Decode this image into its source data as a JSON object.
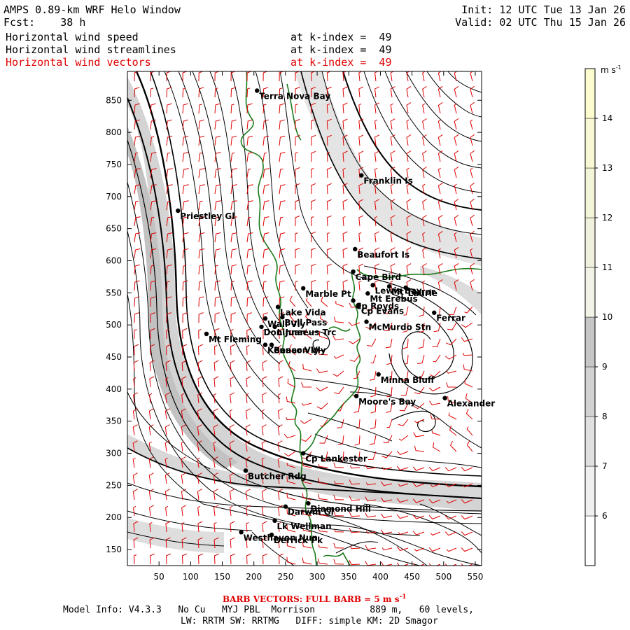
{
  "header": {
    "title": "AMPS 0.89-km WRF Helo Window",
    "fcst_label": "Fcst:",
    "fcst_value": "38 h",
    "init": "Init: 12 UTC Tue 13 Jan 26",
    "valid": "Valid: 02 UTC Thu 15 Jan 26",
    "fields": [
      {
        "name": "Horizontal wind speed",
        "level": "at k-index =  49",
        "color": "#000000"
      },
      {
        "name": "Horizontal wind streamlines",
        "level": "at k-index =  49",
        "color": "#000000"
      },
      {
        "name": "Horizontal wind vectors",
        "level": "at k-index =  49",
        "color": "#e00000"
      }
    ]
  },
  "map": {
    "x_ticks": [
      "50",
      "100",
      "150",
      "200",
      "250",
      "300",
      "350",
      "400",
      "450",
      "500",
      "550"
    ],
    "y_ticks": [
      "850",
      "800",
      "750",
      "700",
      "650",
      "600",
      "550",
      "500",
      "450",
      "400",
      "350",
      "300",
      "250",
      "200",
      "150"
    ],
    "x_range": [
      0,
      560
    ],
    "y_range": [
      125,
      895
    ],
    "coast_color": "#1a7a1a",
    "barb_color": "#e00000",
    "places": [
      {
        "name": "Terra Nova Bay",
        "x": 205,
        "y": 865
      },
      {
        "name": "Franklin Is",
        "x": 370,
        "y": 733
      },
      {
        "name": "Priestley Gl",
        "x": 80,
        "y": 678
      },
      {
        "name": "Beaufort Is",
        "x": 360,
        "y": 618
      },
      {
        "name": "Cape Bird",
        "x": 357,
        "y": 583
      },
      {
        "name": "Marble Pt",
        "x": 278,
        "y": 557
      },
      {
        "name": "Lewis Bay",
        "x": 388,
        "y": 562
      },
      {
        "name": "Mt Terror",
        "x": 414,
        "y": 560
      },
      {
        "name": "Lake Vida",
        "x": 238,
        "y": 528
      },
      {
        "name": "Cp Royds",
        "x": 357,
        "y": 538
      },
      {
        "name": "Mt Erebus",
        "x": 380,
        "y": 549
      },
      {
        "name": "Laurie",
        "x": 440,
        "y": 558
      },
      {
        "name": "Cp Evans",
        "x": 366,
        "y": 530
      },
      {
        "name": "Wall Vly",
        "x": 218,
        "y": 510
      },
      {
        "name": "Bull Pass",
        "x": 245,
        "y": 512
      },
      {
        "name": "McMurdo Stn",
        "x": 378,
        "y": 505
      },
      {
        "name": "Ferrar",
        "x": 485,
        "y": 519
      },
      {
        "name": "Don Juan",
        "x": 212,
        "y": 497
      },
      {
        "name": "Mt Fleming",
        "x": 125,
        "y": 486
      },
      {
        "name": "Linnaeus Trc",
        "x": 233,
        "y": 497
      },
      {
        "name": "Kennar Vly",
        "x": 218,
        "y": 469
      },
      {
        "name": "Beacon Vly",
        "x": 228,
        "y": 469
      },
      {
        "name": "Minna Bluff",
        "x": 397,
        "y": 423
      },
      {
        "name": "Moore's Bay",
        "x": 362,
        "y": 389
      },
      {
        "name": "Alexander",
        "x": 502,
        "y": 386
      },
      {
        "name": "Cp Lankester",
        "x": 278,
        "y": 300
      },
      {
        "name": "Butcher Rdg",
        "x": 187,
        "y": 273
      },
      {
        "name": "Darwin Gl",
        "x": 250,
        "y": 217
      },
      {
        "name": "Diamond Hill",
        "x": 286,
        "y": 222
      },
      {
        "name": "Lk Wellman",
        "x": 233,
        "y": 195
      },
      {
        "name": "Westhaven Nun",
        "x": 180,
        "y": 177
      },
      {
        "name": "Derrick Pk",
        "x": 228,
        "y": 173
      }
    ]
  },
  "colorbar": {
    "unit": "m s-1",
    "labels": [
      "14",
      "13",
      "12",
      "11",
      "10",
      "9",
      "8",
      "7",
      "6"
    ],
    "bands": [
      {
        "min": 5,
        "max": 6,
        "color": "#ffffff"
      },
      {
        "min": 6,
        "max": 7,
        "color": "#f0f0f0"
      },
      {
        "min": 7,
        "max": 8,
        "color": "#e0e0e0"
      },
      {
        "min": 8,
        "max": 9,
        "color": "#d2d2d2"
      },
      {
        "min": 9,
        "max": 10,
        "color": "#c6c6c6"
      },
      {
        "min": 10,
        "max": 11,
        "color": "#f2f2e6"
      },
      {
        "min": 11,
        "max": 12,
        "color": "#f0f0dc"
      },
      {
        "min": 12,
        "max": 13,
        "color": "#f4f4d8"
      },
      {
        "min": 13,
        "max": 14,
        "color": "#f8f8d4"
      },
      {
        "min": 14,
        "max": 15,
        "color": "#fcfcd0"
      }
    ]
  },
  "footer": {
    "barb_note": "BARB VECTORS: FULL BARB = 5 m s",
    "barb_sup": "-1",
    "model_line": "Model Info: V4.3.3   No Cu   MYJ PBL  Morrison          889 m,   60 levels,",
    "physics_line": "LW: RRTM SW: RRTMG   DIFF: simple KM: 2D Smagor"
  }
}
